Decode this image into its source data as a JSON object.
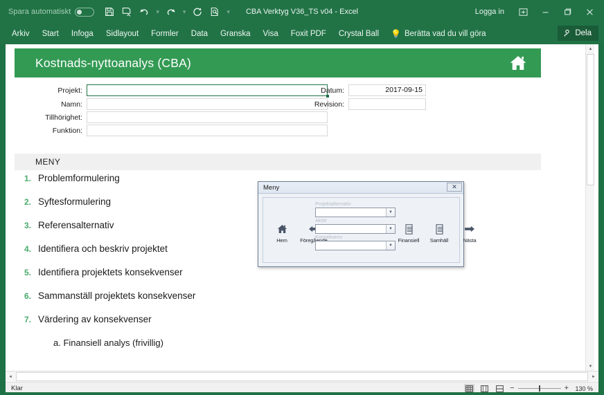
{
  "titlebar": {
    "autosave_label": "Spara automatiskt",
    "autosave_state": "off",
    "document_title": "CBA Verktyg V36_TS v04  -  Excel",
    "sign_in": "Logga in",
    "quick_access": [
      {
        "name": "save-icon",
        "label": "Spara"
      },
      {
        "name": "save-as-icon",
        "label": "Spara som"
      },
      {
        "name": "undo-icon",
        "label": "Ångra"
      },
      {
        "name": "redo-icon",
        "label": "Gör om"
      },
      {
        "name": "refresh-icon",
        "label": "Uppdatera"
      },
      {
        "name": "print-preview-icon",
        "label": "Förhandsgranska"
      },
      {
        "name": "customize-qat-icon",
        "label": "Anpassa verktygsfältet"
      }
    ],
    "window_buttons": [
      {
        "name": "ribbon-display-options",
        "label": "Menyflikvisningsalternativ"
      },
      {
        "name": "minimize",
        "label": "Minimera"
      },
      {
        "name": "restore",
        "label": "Återställ"
      },
      {
        "name": "close",
        "label": "Stäng"
      }
    ]
  },
  "ribbon": {
    "tabs": [
      "Arkiv",
      "Start",
      "Infoga",
      "Sidlayout",
      "Formler",
      "Data",
      "Granska",
      "Visa",
      "Foxit PDF",
      "Crystal Ball"
    ],
    "tell_me": "Berätta vad du vill göra",
    "share_label": "Dela"
  },
  "banner": {
    "title": "Kostnads-nyttoanalys (CBA)",
    "home_icon": "home-icon",
    "color": "#339a54"
  },
  "form": {
    "left": [
      {
        "label": "Projekt:",
        "value": "",
        "selected": true
      },
      {
        "label": "Namn:",
        "value": "",
        "selected": false
      },
      {
        "label": "Tillhörighet:",
        "value": "",
        "selected": false
      },
      {
        "label": "Funktion:",
        "value": "",
        "selected": false
      }
    ],
    "right": [
      {
        "label": "Datum:",
        "value": "2017-09-15"
      },
      {
        "label": "Revision:",
        "value": ""
      }
    ]
  },
  "menu_section": {
    "heading": "MENY",
    "items": [
      {
        "num": "1.",
        "text": "Problemformulering",
        "sub": false
      },
      {
        "num": "2.",
        "text": "Syftesformulering",
        "sub": false
      },
      {
        "num": "3.",
        "text": "Referensalternativ",
        "sub": false
      },
      {
        "num": "4.",
        "text": "Identifiera och beskriv projektet",
        "sub": false
      },
      {
        "num": "5.",
        "text": "Identifiera projektets konsekvenser",
        "sub": false
      },
      {
        "num": "6.",
        "text": "Sammanställ projektets konsekvenser",
        "sub": false
      },
      {
        "num": "7.",
        "text": "Värdering av konsekvenser",
        "sub": false
      },
      {
        "num": "",
        "text": "a. Finansiell analys (frivillig)",
        "sub": true
      }
    ],
    "number_color": "#4aab6c"
  },
  "dialog": {
    "title": "Meny",
    "close_label": "✕",
    "left_buttons": [
      {
        "icon": "home-icon",
        "label": "Hem"
      },
      {
        "icon": "arrow-left-icon",
        "label": "Föregående"
      }
    ],
    "right_buttons": [
      {
        "icon": "report-icon",
        "label": "Finansiell"
      },
      {
        "icon": "report-icon",
        "label": "Samhäll"
      },
      {
        "icon": "arrow-right-icon",
        "label": "Nästa"
      }
    ],
    "fields": [
      {
        "label": "Projektalternativ",
        "value": ""
      },
      {
        "label": "Aktör",
        "value": ""
      },
      {
        "label": "Konsekvens",
        "value": ""
      }
    ]
  },
  "statusbar": {
    "status": "Klar",
    "views": [
      {
        "name": "normal-view-icon",
        "label": "Normal",
        "active": true
      },
      {
        "name": "page-layout-view-icon",
        "label": "Sidlayout",
        "active": false
      },
      {
        "name": "page-break-view-icon",
        "label": "Förhandsgranska sidbrytning",
        "active": false
      }
    ],
    "zoom_out": "−",
    "zoom_in": "+",
    "zoom_value": "130 %"
  }
}
